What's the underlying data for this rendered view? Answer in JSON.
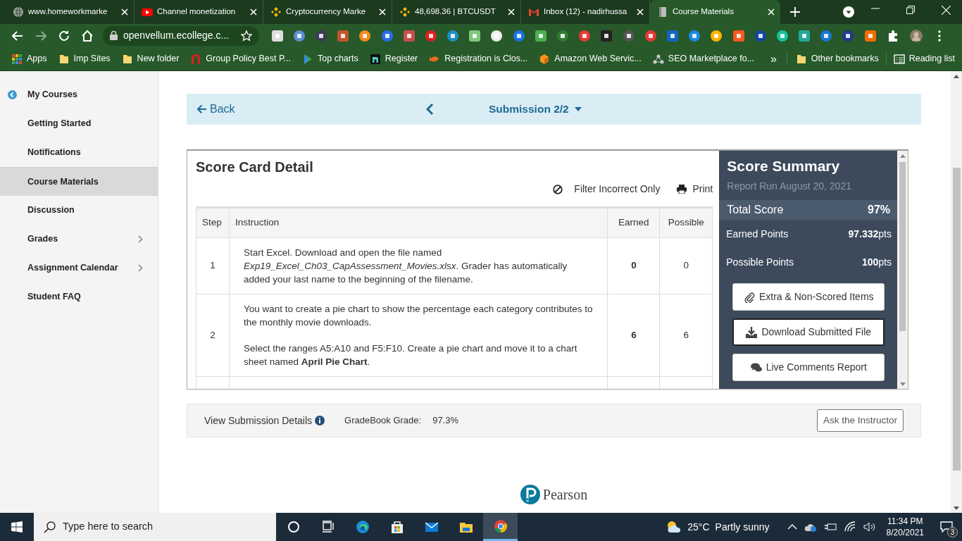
{
  "browser": {
    "tabs": [
      {
        "title": "www.homeworkmarke",
        "selected": false
      },
      {
        "title": "Channel monetization",
        "selected": false
      },
      {
        "title": "Cryptocurrency Marke",
        "selected": false
      },
      {
        "title": "48,698.36 | BTCUSDT",
        "selected": false
      },
      {
        "title": "Inbox (12) - nadirhussa",
        "selected": false
      },
      {
        "title": "Course Materials",
        "selected": true
      }
    ],
    "address": "openvellum.ecollege.c...",
    "bookmarks": [
      {
        "label": "Apps"
      },
      {
        "label": "Imp Sites"
      },
      {
        "label": "New folder"
      },
      {
        "label": "Group Policy Best P..."
      },
      {
        "label": "Top charts"
      },
      {
        "label": "Register"
      },
      {
        "label": "Registration is Clos..."
      },
      {
        "label": "Amazon Web Servic..."
      },
      {
        "label": "SEO Marketplace fo..."
      }
    ],
    "more": "»",
    "other_bookmarks": "Other bookmarks",
    "reading_list": "Reading list"
  },
  "sidebar": {
    "items": [
      {
        "label": "My Courses",
        "kind": "back",
        "selected": false
      },
      {
        "label": "Getting Started",
        "kind": "link",
        "selected": false
      },
      {
        "label": "Notifications",
        "kind": "link",
        "selected": false
      },
      {
        "label": "Course Materials",
        "kind": "link",
        "selected": true
      },
      {
        "label": "Discussion",
        "kind": "link",
        "selected": false
      },
      {
        "label": "Grades",
        "kind": "submenu",
        "selected": false
      },
      {
        "label": "Assignment Calendar",
        "kind": "submenu",
        "selected": false
      },
      {
        "label": "Student FAQ",
        "kind": "link",
        "selected": false
      }
    ]
  },
  "submission_bar": {
    "back": "Back",
    "title": "Submission 2/2"
  },
  "score_card": {
    "title": "Score Card Detail",
    "filter": "Filter Incorrect Only",
    "print": "Print",
    "columns": [
      "Step",
      "Instruction",
      "Earned",
      "Possible"
    ],
    "rows": [
      {
        "step": "1",
        "instruction": [
          "Start Excel. Download and open the file named *Exp19_Excel_Ch03_CapAssessment_Movies.xlsx*. Grader has automatically added your last name to the beginning of the filename."
        ],
        "earned": "0",
        "possible": "0"
      },
      {
        "step": "2",
        "instruction": [
          "You want to create a pie chart to show the percentage each category contributes to the monthly movie downloads.",
          "Select the ranges A5:A10 and F5:F10. Create a pie chart and move it to a chart sheet named **April Pie Chart**."
        ],
        "earned": "6",
        "possible": "6"
      }
    ]
  },
  "summary": {
    "title": "Score Summary",
    "report_run": "Report Run August 20, 2021",
    "total": {
      "label": "Total Score",
      "value": "97%"
    },
    "stats": [
      {
        "label": "Earned Points",
        "value": "97.332",
        "unit": "pts"
      },
      {
        "label": "Possible Points",
        "value": "100",
        "unit": "pts"
      }
    ],
    "buttons": [
      {
        "label": "Extra & Non-Scored Items",
        "focused": false
      },
      {
        "label": "Download Submitted File",
        "focused": true
      },
      {
        "label": "Live Comments Report",
        "focused": false
      }
    ]
  },
  "footer": {
    "details": "View Submission Details",
    "grade_label": "GradeBook Grade:",
    "grade_value": "97.3%",
    "ask": "Ask the Instructor"
  },
  "brand": "Pearson",
  "taskbar": {
    "search_placeholder": "Type here to search",
    "apps": [
      {
        "selected": false
      },
      {
        "selected": false
      },
      {
        "selected": false
      },
      {
        "selected": false
      },
      {
        "selected": false
      },
      {
        "selected": false
      },
      {
        "selected": true
      }
    ],
    "temperature": "25°C",
    "weather": "Partly sunny",
    "time": "11:34 PM",
    "date": "8/20/2021",
    "notifications": "3"
  }
}
